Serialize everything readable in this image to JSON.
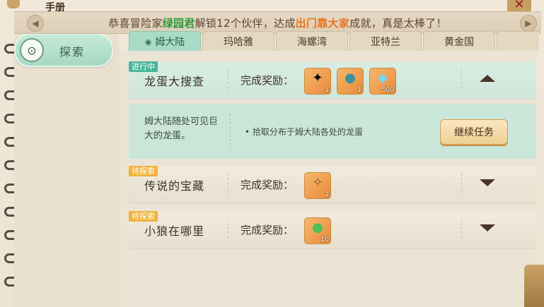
{
  "book": {
    "title": "手册"
  },
  "banner": {
    "prefix": "恭喜冒险家",
    "player": "绿园君",
    "middle": "解锁12个伙伴，达成",
    "achievement": "出门靠大家",
    "suffix": "成就，真是太棒了！"
  },
  "sidebar": {
    "explore_label": "探索"
  },
  "tabs": [
    {
      "label": "姆大陆",
      "active": true
    },
    {
      "label": "玛哈雅",
      "active": false
    },
    {
      "label": "海螺湾",
      "active": false
    },
    {
      "label": "亚特兰",
      "active": false
    },
    {
      "label": "黄金国",
      "active": false
    }
  ],
  "tasks": [
    {
      "status": "进行中",
      "title": "龙蛋大搜查",
      "reward_label": "完成奖励：",
      "rewards": [
        {
          "icon": "firework-icon",
          "qty": "1"
        },
        {
          "icon": "dragon-egg-icon",
          "qty": "1"
        },
        {
          "icon": "diamond-icon",
          "qty": "500"
        }
      ],
      "expanded": true,
      "description": "姆大陆随处可见巨大的龙蛋。",
      "goal": "• 拾取分布于姆大陆各处的龙蛋",
      "action_label": "继续任务"
    },
    {
      "status": "待探索",
      "title": "传说的宝藏",
      "reward_label": "完成奖励：",
      "rewards": [
        {
          "icon": "treasure-map-icon",
          "qty": "2"
        }
      ],
      "expanded": false
    },
    {
      "status": "待探索",
      "title": "小狼在哪里",
      "reward_label": "完成奖励：",
      "rewards": [
        {
          "icon": "green-gem-icon",
          "qty": "10"
        }
      ],
      "expanded": false
    }
  ],
  "colors": {
    "status_in_progress": "#4bb59a",
    "status_pending": "#f1b33c",
    "tab_active": "#a9dcc6"
  }
}
